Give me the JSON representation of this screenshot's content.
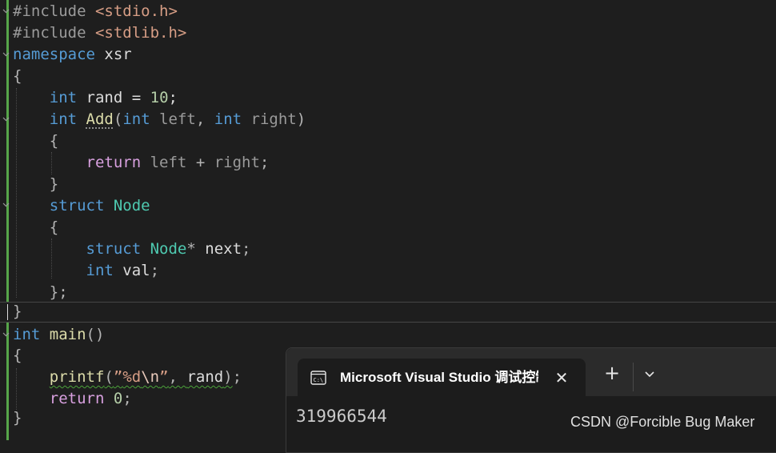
{
  "editor": {
    "lines": {
      "l1": {
        "pre": "#include",
        "hdr": "<stdio.h>"
      },
      "l2": {
        "pre": "#include",
        "hdr": "<stdlib.h>"
      },
      "l3": {
        "kw": "namespace",
        "name": "xsr"
      },
      "l4": {
        "brace": "{"
      },
      "l5": {
        "type": "int",
        "name": "rand",
        "op": " = ",
        "num": "10",
        "end": ";"
      },
      "l6": {
        "type": "int",
        "fn": "Add",
        "open": "(",
        "t1": "int",
        "p1": "left",
        "comma": ", ",
        "t2": "int",
        "p2": "right",
        "close": ")"
      },
      "l7": {
        "brace": "{"
      },
      "l8": {
        "kw": "return",
        "p1": "left",
        "op": " + ",
        "p2": "right",
        "end": ";"
      },
      "l9": {
        "brace": "}"
      },
      "l10": {
        "kw": "struct",
        "type": "Node"
      },
      "l11": {
        "brace": "{"
      },
      "l12": {
        "kw": "struct",
        "type": "Node",
        "star": "*",
        "name": "next",
        "end": ";"
      },
      "l13": {
        "kw": "int",
        "name": "val",
        "end": ";"
      },
      "l14": {
        "brace": "};"
      },
      "l15": {
        "brace": "}"
      },
      "l16": {
        "kw": "int",
        "fn": "main",
        "parens": "()"
      },
      "l17": {
        "brace": "{"
      },
      "l18": {
        "fn": "printf",
        "open": "(",
        "q1": "”",
        "fmt": "%d",
        "esc": "\\n",
        "q2": "”",
        "comma": ", ",
        "arg": "rand",
        "close": ")",
        "end": ";"
      },
      "l19": {
        "kw": "return",
        "num": "0",
        "end": ";"
      },
      "l20": {
        "brace": "}"
      }
    }
  },
  "terminal": {
    "tab_title": "Microsoft Visual Studio 调试控制台",
    "close_glyph": "✕",
    "new_tab_glyph": "+",
    "output": "319966544"
  },
  "watermark": "CSDN @Forcible Bug Maker",
  "colors": {
    "background": "#1e1e1e",
    "keyword": "#569cd6",
    "control_keyword": "#d8a0df",
    "type": "#4ec9b0",
    "function": "#dcdcaa",
    "string": "#d69d85",
    "number": "#b5cea8",
    "change_bar": "#57a64a"
  }
}
